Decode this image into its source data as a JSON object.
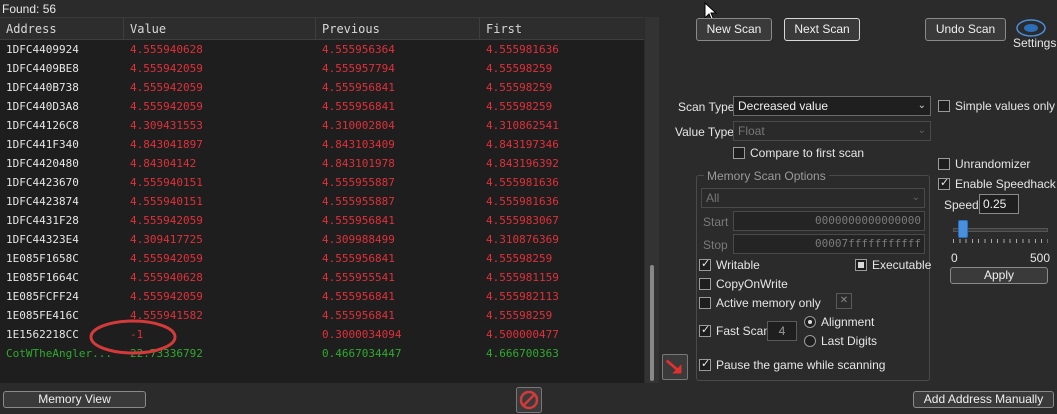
{
  "found": {
    "label": "Found: 56"
  },
  "columns": {
    "address": "Address",
    "value": "Value",
    "previous": "Previous",
    "first": "First"
  },
  "rows": [
    {
      "address": "1DFC4409924",
      "value": "4.555940628",
      "previous": "4.555956364",
      "first": "4.555981636"
    },
    {
      "address": "1DFC4409BE8",
      "value": "4.555942059",
      "previous": "4.555957794",
      "first": "4.55598259"
    },
    {
      "address": "1DFC440B738",
      "value": "4.555942059",
      "previous": "4.555956841",
      "first": "4.55598259"
    },
    {
      "address": "1DFC440D3A8",
      "value": "4.555942059",
      "previous": "4.555956841",
      "first": "4.55598259"
    },
    {
      "address": "1DFC44126C8",
      "value": "4.309431553",
      "previous": "4.310002804",
      "first": "4.310862541"
    },
    {
      "address": "1DFC441F340",
      "value": "4.843041897",
      "previous": "4.843103409",
      "first": "4.843197346"
    },
    {
      "address": "1DFC4420480",
      "value": "4.84304142",
      "previous": "4.843101978",
      "first": "4.843196392"
    },
    {
      "address": "1DFC4423670",
      "value": "4.555940151",
      "previous": "4.555955887",
      "first": "4.555981636"
    },
    {
      "address": "1DFC4423874",
      "value": "4.555940151",
      "previous": "4.555955887",
      "first": "4.555981636"
    },
    {
      "address": "1DFC4431F28",
      "value": "4.555942059",
      "previous": "4.555956841",
      "first": "4.555983067"
    },
    {
      "address": "1DFC44323E4",
      "value": "4.309417725",
      "previous": "4.309988499",
      "first": "4.310876369"
    },
    {
      "address": "1E085F1658C",
      "value": "4.555942059",
      "previous": "4.555956841",
      "first": "4.55598259"
    },
    {
      "address": "1E085F1664C",
      "value": "4.555940628",
      "previous": "4.555955541",
      "first": "4.555981159"
    },
    {
      "address": "1E085FCFF24",
      "value": "4.555942059",
      "previous": "4.555956841",
      "first": "4.555982113"
    },
    {
      "address": "1E085FE416C",
      "value": "4.555941582",
      "previous": "4.555956841",
      "first": "4.55598259"
    },
    {
      "address": "1E1562218CC",
      "value": "-1",
      "previous": "0.3000034094",
      "first": "4.500000477"
    },
    {
      "address": "CotWTheAngler...",
      "value": "22.73336792",
      "previous": "0.4667034447",
      "first": "4.666700363",
      "green": true
    }
  ],
  "buttons": {
    "new_scan": "New Scan",
    "next_scan": "Next Scan",
    "undo_scan": "Undo Scan",
    "settings": "Settings",
    "memory_view": "Memory View",
    "add_address": "Add Address Manually",
    "apply": "Apply"
  },
  "scan": {
    "scan_type_label": "Scan Type",
    "scan_type_value": "Decreased value",
    "value_type_label": "Value Type",
    "value_type_value": "Float",
    "compare_first": "Compare to first scan",
    "simple_values": "Simple values only"
  },
  "memory": {
    "title": "Memory Scan Options",
    "region": "All",
    "start_label": "Start",
    "start_value": "0000000000000000",
    "stop_label": "Stop",
    "stop_value": "00007fffffffffff",
    "writable": "Writable",
    "executable": "Executable",
    "copy_on_write": "CopyOnWrite",
    "active_memory": "Active memory only",
    "fast_scan": "Fast Scan",
    "fast_scan_value": "4",
    "alignment": "Alignment",
    "last_digits": "Last Digits",
    "pause_game": "Pause the game while scanning"
  },
  "speedhack": {
    "unrandomizer": "Unrandomizer",
    "enable": "Enable Speedhack",
    "speed_label": "Speed",
    "speed_value": "0.25",
    "min": "0",
    "max": "500",
    "slider_fraction": 0.025
  },
  "colors": {
    "value_red": "#e0303a",
    "green_text": "#2eaa2e",
    "annotation": "#d43a3a"
  }
}
